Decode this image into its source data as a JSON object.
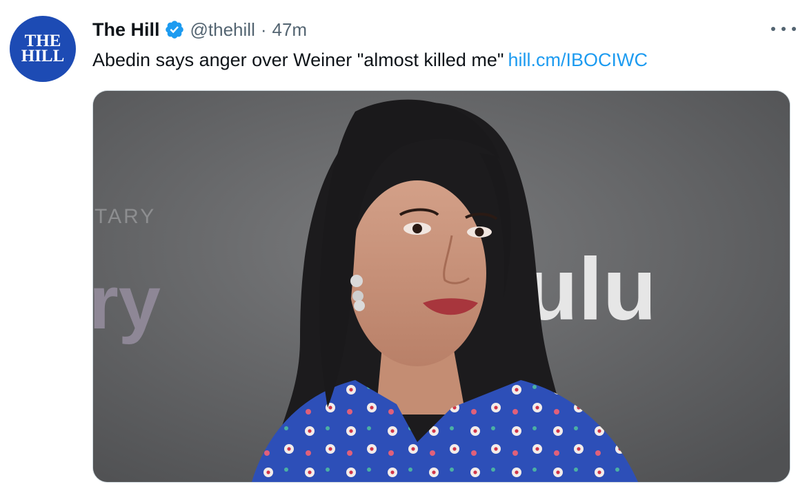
{
  "tweet": {
    "avatar": {
      "lines": [
        "THE",
        "HILL"
      ],
      "color": "#1d4bb4"
    },
    "display_name": "The Hill",
    "verified_icon": "verified-badge-icon",
    "handle": "@thehill",
    "separator": "·",
    "time": "47m",
    "more_icon": "more-options-icon",
    "text": "Abedin says anger over Weiner \"almost killed me\"",
    "link": "hill.cm/IBOCIWC",
    "link_color": "#1d9bf0"
  },
  "media": {
    "backdrop_text": {
      "top": "TARY",
      "left": "ry",
      "right": "ulu"
    }
  }
}
